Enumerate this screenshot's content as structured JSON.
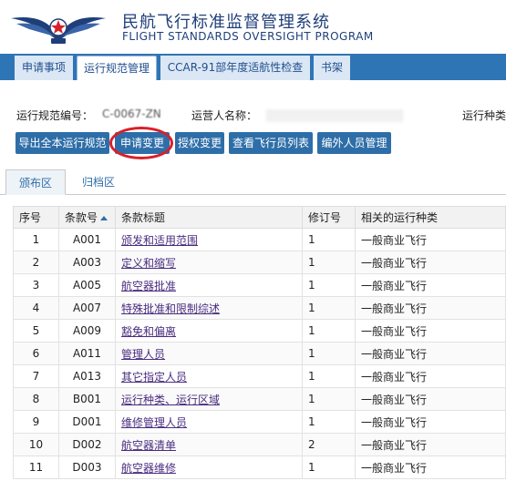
{
  "app": {
    "title_cn": "民航飞行标准监督管理系统",
    "title_en": "FLIGHT STANDARDS OVERSIGHT PROGRAM"
  },
  "main_tabs": [
    {
      "label": "申请事项",
      "active": false
    },
    {
      "label": "运行规范管理",
      "active": true
    },
    {
      "label": "CCAR-91部年度适航性检查",
      "active": false
    },
    {
      "label": "书架",
      "active": false
    }
  ],
  "info": {
    "spec_number_label": "运行规范编号：",
    "spec_number_value": "C-0067-ZN",
    "operator_label": "运营人名称：",
    "run_type_label": "运行种类"
  },
  "buttons": {
    "export_all": "导出全本运行规范",
    "apply_change": "申请变更",
    "auth_change": "授权变更",
    "view_pilots": "查看飞行员列表",
    "external_staff": "编外人员管理"
  },
  "sub_tabs": [
    {
      "label": "颁布区",
      "active": true
    },
    {
      "label": "归档区",
      "active": false
    }
  ],
  "table": {
    "headers": [
      "序号",
      "条款号",
      "条款标题",
      "修订号",
      "相关的运行种类"
    ],
    "rows": [
      [
        "1",
        "A001",
        "颁发和适用范围",
        "1",
        "一般商业飞行"
      ],
      [
        "2",
        "A003",
        "定义和缩写",
        "1",
        "一般商业飞行"
      ],
      [
        "3",
        "A005",
        "航空器批准",
        "1",
        "一般商业飞行"
      ],
      [
        "4",
        "A007",
        "特殊批准和限制综述",
        "1",
        "一般商业飞行"
      ],
      [
        "5",
        "A009",
        "豁免和偏离",
        "1",
        "一般商业飞行"
      ],
      [
        "6",
        "A011",
        "管理人员",
        "1",
        "一般商业飞行"
      ],
      [
        "7",
        "A013",
        "其它指定人员",
        "1",
        "一般商业飞行"
      ],
      [
        "8",
        "B001",
        "运行种类、运行区域",
        "1",
        "一般商业飞行"
      ],
      [
        "9",
        "D001",
        "维修管理人员",
        "1",
        "一般商业飞行"
      ],
      [
        "10",
        "D002",
        "航空器清单",
        "2",
        "一般商业飞行"
      ],
      [
        "11",
        "D003",
        "航空器维修",
        "1",
        "一般商业飞行"
      ]
    ]
  },
  "colors": {
    "primary": "#2e75b6",
    "button": "#2e6ea8",
    "highlight_ring": "#d8202a",
    "link": "#4a2d7f"
  }
}
